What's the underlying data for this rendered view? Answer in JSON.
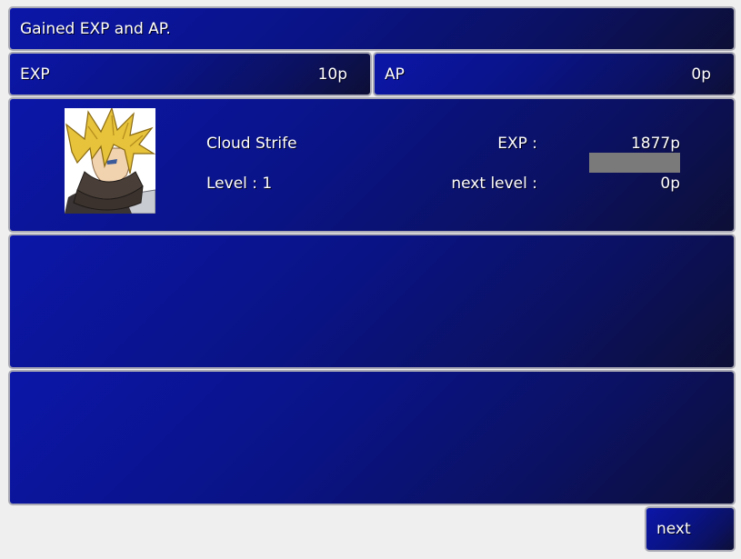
{
  "message": "Gained EXP and AP.",
  "rewards": {
    "exp_label": "EXP",
    "exp_value": "10p",
    "ap_label": "AP",
    "ap_value": "0p"
  },
  "character": {
    "name": "Cloud Strife",
    "level_text": "Level : 1",
    "exp_label": "EXP :",
    "exp_value": "1877p",
    "next_label": "next level :",
    "next_value": "0p",
    "exp_progress": 0,
    "portrait_icon": "cloud-strife-portrait"
  },
  "buttons": {
    "next_label": "next"
  },
  "colors": {
    "panel_gradient_start": "#0b16a8",
    "panel_gradient_end": "#0d0f36",
    "panel_border": "#a8a8b4",
    "bar_track": "#7a7a7a"
  }
}
